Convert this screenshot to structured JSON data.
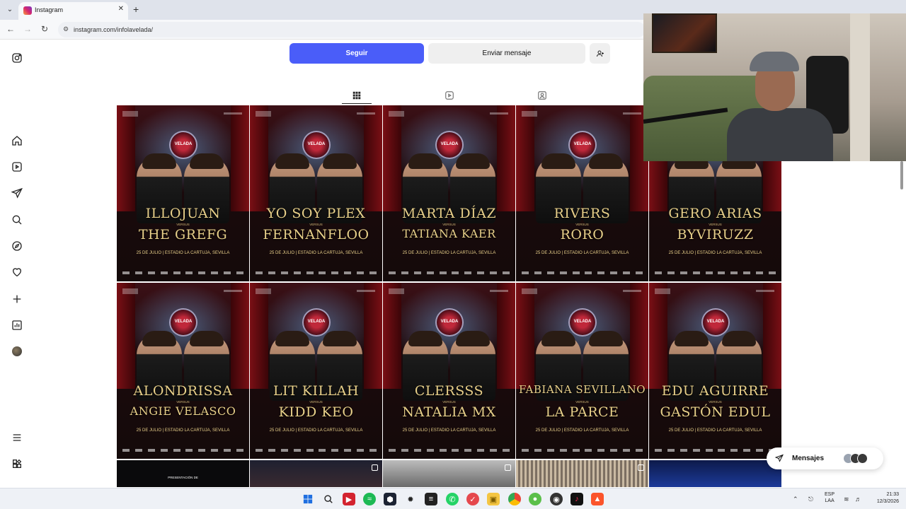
{
  "browser": {
    "tab_title": "Instagram",
    "url": "instagram.com/infolavelada/"
  },
  "profile": {
    "follow_label": "Seguir",
    "message_label": "Enviar mensaje"
  },
  "posts": [
    {
      "a": "ILLOJUAN",
      "b": "THE GREFG"
    },
    {
      "a": "YO SOY PLEX",
      "b": "FERNANFLOO"
    },
    {
      "a": "MARTA DÍAZ",
      "b": "TATIANA KAER"
    },
    {
      "a": "RIVERS",
      "b": "RORO"
    },
    {
      "a": "GERO ARIAS",
      "b": "BYVIRUZZ"
    },
    {
      "a": "ALONDRISSA",
      "b": "ANGIE VELASCO"
    },
    {
      "a": "LIT KILLAH",
      "b": "KIDD KEO"
    },
    {
      "a": "CLERSSS",
      "b": "NATALIA MX"
    },
    {
      "a": "FABIANA SEVILLANO",
      "b": "LA PARCE"
    },
    {
      "a": "EDU AGUIRRE",
      "b": "GASTÓN EDUL"
    }
  ],
  "post_common": {
    "versus": "VERSUS",
    "event": "25 DE JULIO | ESTADIO LA CARTUJA, SEVILLA",
    "logo": "VELADA"
  },
  "thumb_caption": "PRESENTACIÓN DE",
  "messages": {
    "label": "Mensajes"
  },
  "taskbar": {
    "lang_line1": "ESP",
    "lang_line2": "LAA",
    "time": "21:33",
    "date": "12/3/2026"
  }
}
